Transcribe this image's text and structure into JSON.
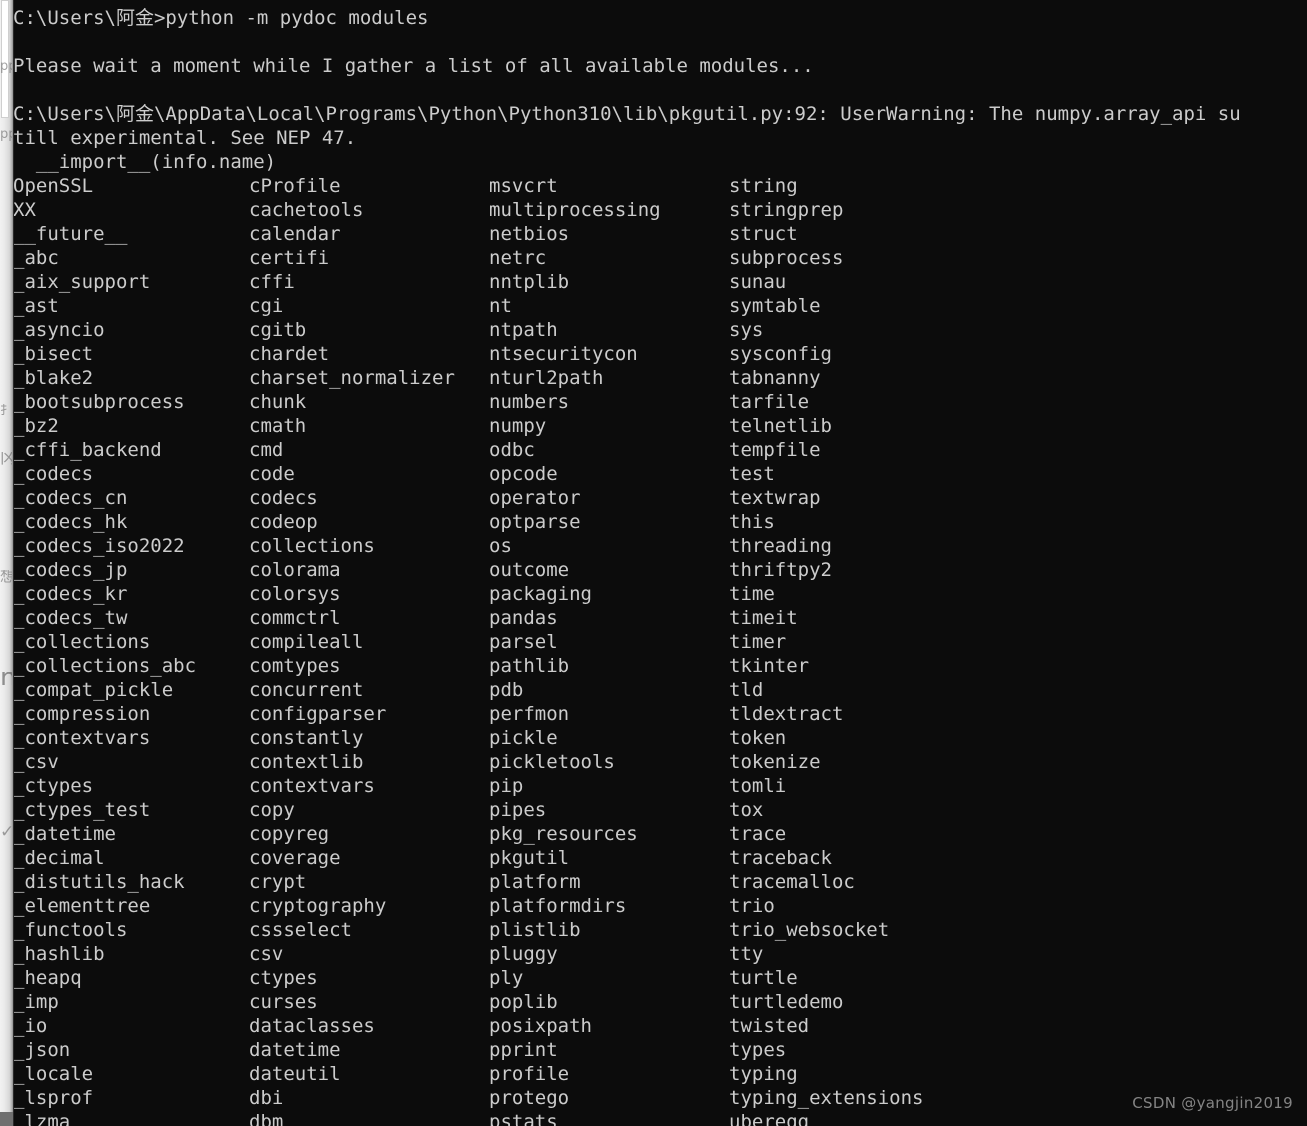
{
  "window": {
    "type": "windows-command-prompt",
    "background_color": "#0c0c0c",
    "text_color": "#cccccc"
  },
  "background_window": {
    "description": "sliver of a light window behind the console",
    "marks": [
      "pp",
      "pp",
      "扌",
      "冈",
      "想",
      "n",
      "✓"
    ]
  },
  "header": {
    "prompt_line": "C:\\Users\\阿金>python -m pydoc modules",
    "blank_1": "",
    "wait_line": "Please wait a moment while I gather a list of all available modules...",
    "blank_2": "",
    "warning_line": "C:\\Users\\阿金\\AppData\\Local\\Programs\\Python\\Python310\\lib\\pkgutil.py:92: UserWarning: The numpy.array_api su",
    "warning_line_2": "till experimental. See NEP 47.",
    "warning_line_3": "  __import__(info.name)"
  },
  "modules": {
    "columns": [
      [
        "OpenSSL",
        "XX",
        "__future__",
        "_abc",
        "_aix_support",
        "_ast",
        "_asyncio",
        "_bisect",
        "_blake2",
        "_bootsubprocess",
        "_bz2",
        "_cffi_backend",
        "_codecs",
        "_codecs_cn",
        "_codecs_hk",
        "_codecs_iso2022",
        "_codecs_jp",
        "_codecs_kr",
        "_codecs_tw",
        "_collections",
        "_collections_abc",
        "_compat_pickle",
        "_compression",
        "_contextvars",
        "_csv",
        "_ctypes",
        "_ctypes_test",
        "_datetime",
        "_decimal",
        "_distutils_hack",
        "_elementtree",
        "_functools",
        "_hashlib",
        "_heapq",
        "_imp",
        "_io",
        "_json",
        "_locale",
        "_lsprof",
        "_lzma"
      ],
      [
        "cProfile",
        "cachetools",
        "calendar",
        "certifi",
        "cffi",
        "cgi",
        "cgitb",
        "chardet",
        "charset_normalizer",
        "chunk",
        "cmath",
        "cmd",
        "code",
        "codecs",
        "codeop",
        "collections",
        "colorama",
        "colorsys",
        "commctrl",
        "compileall",
        "comtypes",
        "concurrent",
        "configparser",
        "constantly",
        "contextlib",
        "contextvars",
        "copy",
        "copyreg",
        "coverage",
        "crypt",
        "cryptography",
        "cssselect",
        "csv",
        "ctypes",
        "curses",
        "dataclasses",
        "datetime",
        "dateutil",
        "dbi",
        "dbm"
      ],
      [
        "msvcrt",
        "multiprocessing",
        "netbios",
        "netrc",
        "nntplib",
        "nt",
        "ntpath",
        "ntsecuritycon",
        "nturl2path",
        "numbers",
        "numpy",
        "odbc",
        "opcode",
        "operator",
        "optparse",
        "os",
        "outcome",
        "packaging",
        "pandas",
        "parsel",
        "pathlib",
        "pdb",
        "perfmon",
        "pickle",
        "pickletools",
        "pip",
        "pipes",
        "pkg_resources",
        "pkgutil",
        "platform",
        "platformdirs",
        "plistlib",
        "pluggy",
        "ply",
        "poplib",
        "posixpath",
        "pprint",
        "profile",
        "protego",
        "pstats"
      ],
      [
        "string",
        "stringprep",
        "struct",
        "subprocess",
        "sunau",
        "symtable",
        "sys",
        "sysconfig",
        "tabnanny",
        "tarfile",
        "telnetlib",
        "tempfile",
        "test",
        "textwrap",
        "this",
        "threading",
        "thriftpy2",
        "time",
        "timeit",
        "timer",
        "tkinter",
        "tld",
        "tldextract",
        "token",
        "tokenize",
        "tomli",
        "tox",
        "trace",
        "traceback",
        "tracemalloc",
        "trio",
        "trio_websocket",
        "tty",
        "turtle",
        "turtledemo",
        "twisted",
        "types",
        "typing",
        "typing_extensions",
        "uberegg"
      ]
    ]
  },
  "watermark": {
    "text": "CSDN @yangjin2019"
  }
}
